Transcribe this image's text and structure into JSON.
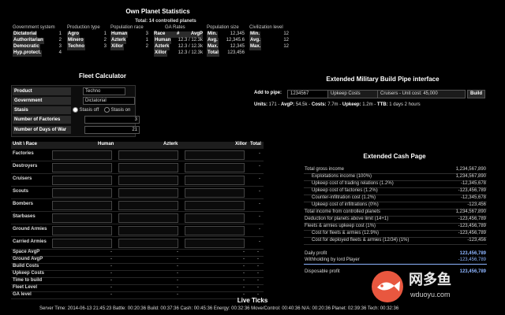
{
  "own_planet": {
    "title": "Own Planet Statistics",
    "subtitle": "Total: 14 controlled planets",
    "gov": {
      "header": "Government system",
      "rows": [
        [
          "Dictatorial",
          "1"
        ],
        [
          "Authoritarian",
          "2"
        ],
        [
          "Democratic",
          "3"
        ],
        [
          "Hyp.protect.",
          "4"
        ]
      ]
    },
    "prod": {
      "header": "Production type",
      "rows": [
        [
          "Agro",
          "1"
        ],
        [
          "Minero",
          "2"
        ],
        [
          "Techno",
          "3"
        ]
      ]
    },
    "race": {
      "header": "Population race",
      "rows": [
        [
          "Human",
          "3"
        ],
        [
          "Azterk",
          "1"
        ],
        [
          "Xillor",
          "2"
        ]
      ]
    },
    "ga": {
      "header": "GA Rates",
      "col_race": "Race",
      "col_num": "#",
      "col_avgp": "AvgP",
      "rows": [
        [
          "Human",
          "12.3 / 12.3k"
        ],
        [
          "Azterk",
          "12.3 / 12.3k"
        ],
        [
          "Xillor",
          "12.3 / 12.3k"
        ]
      ]
    },
    "pop": {
      "header": "Population size",
      "rows": [
        [
          "Min.",
          "12,345"
        ],
        [
          "Avg.",
          "12,345.6"
        ],
        [
          "Max.",
          "12,345"
        ],
        [
          "Total",
          "123,456"
        ]
      ]
    },
    "civ": {
      "header": "Civilization level",
      "rows": [
        [
          "Min.",
          "12"
        ],
        [
          "Avg.",
          "12"
        ],
        [
          "Max.",
          "12"
        ]
      ]
    }
  },
  "fleet_calc": {
    "title": "Fleet Calculator",
    "product_label": "Product",
    "product_value": "Techno",
    "gov_label": "Government",
    "gov_value": "Dictatorial",
    "stasis_label": "Stasis",
    "stasis_off": "Stasis off",
    "stasis_on": "Stasis on",
    "factories_label": "Number of Factories",
    "factories_value": "3",
    "days_label": "Number of Days of War",
    "days_value": "21"
  },
  "fleet_table": {
    "headers": {
      "unit": "Unit \\ Race",
      "human": "Human",
      "azterk": "Azterk",
      "xillor": "Xillor",
      "total": "Total"
    },
    "input_rows": [
      "Factories",
      "Destroyers",
      "Cruisers",
      "Scouts",
      "Bombers",
      "Starbases",
      "Ground Armies",
      "Carried Armies"
    ],
    "stat_rows": [
      "Space AvgP",
      "Ground AvgP",
      "Build Costs",
      "Upkeep Costs",
      "Time to build",
      "Fleet Level",
      "GA level"
    ],
    "dash": "-"
  },
  "military": {
    "title": "Extended Military Build Pipe interface",
    "add_label": "Add to pipe:",
    "add_value": "1234567",
    "select1": "Upkeep Costs",
    "select2": "Cruisers - Unit cost: 45,000",
    "build_btn": "Build",
    "units_label": "Units:",
    "units_value": "171",
    "avgp_label": "AvgP:",
    "avgp_value": "54.5k",
    "costs_label": "Costs:",
    "costs_value": "7.7m",
    "upkeep_label": "Upkeep:",
    "upkeep_value": "1.2m",
    "ttb_label": "TTB:",
    "ttb_value": "1 days 2 hours"
  },
  "cash": {
    "title": "Extended Cash Page",
    "rows": [
      {
        "l": "Total gross income",
        "v": "1,234,567,890"
      },
      {
        "l": "Exploitations income (100%)",
        "v": "1,234,567,890",
        "ind": true
      },
      {
        "l": "Upkeep cost of trading relations (1.2%)",
        "v": "-12,345,678",
        "ind": true
      },
      {
        "l": "Upkeep cost of factories (1.2%)",
        "v": "-123,456,789",
        "ind": true
      },
      {
        "l": "Counter-infiltration cost (1.2%)",
        "v": "-12,345,678",
        "ind": true
      },
      {
        "l": "Upkeep cost of infiltrations (0%)",
        "v": "-123,456",
        "ind": true
      },
      {
        "l": "Total income from controlled planets",
        "v": "1,234,567,890"
      },
      {
        "l": "Deduction for planets above limit (14+1)",
        "v": "-123,456,789"
      },
      {
        "l": "Fleets & armies upkeep cost (1%)",
        "v": "-123,456,789"
      },
      {
        "l": "Cost for fleets & armies (12.9%)",
        "v": "-123,456,789",
        "ind": true
      },
      {
        "l": "Cost for deployed fleets & armies (12/34) (1%)",
        "v": "-123,456",
        "ind": true
      }
    ],
    "daily_label": "Daily profit",
    "daily_value": "123,456,789",
    "withhold_label": "Withholding by lord Player",
    "withhold_value": "-123,456,789",
    "disp_label": "Disposable profit",
    "disp_value": "123,456,789"
  },
  "ticks": {
    "title": "Live Ticks",
    "text": "Server Time: 2014-06-13 21:45:23    Battle: 00:20:36    Build: 00:37:36    Cash: 00:45:36    Energy: 00:32:36    Move/Control: 00:40:36    N/A: 00:20:36    Planet: 02:39:36    Tech: 00:32:36"
  },
  "watermark": {
    "cn": "网多鱼",
    "en": "wduoyu.com",
    "color": "#e8573f"
  }
}
